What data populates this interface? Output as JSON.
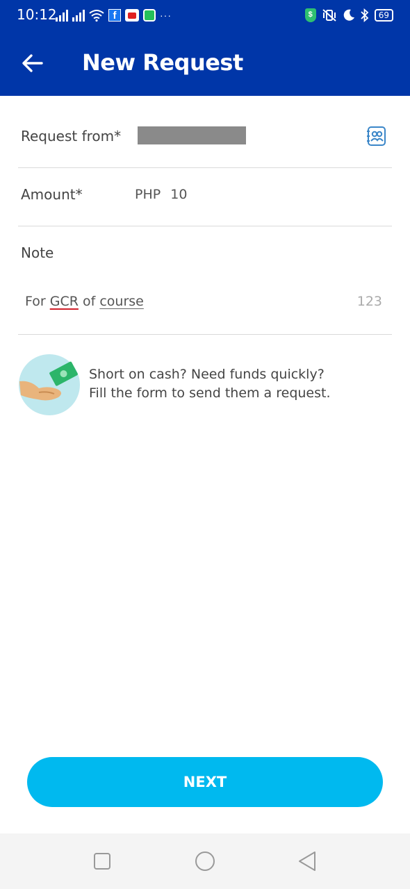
{
  "status_bar": {
    "time": "10:12",
    "battery": "69",
    "shield_glyph": "$",
    "overflow": "···",
    "facebook_glyph": "f",
    "icons": [
      "signal-icon",
      "wifi-icon",
      "facebook-icon",
      "youtube-icon",
      "message-icon",
      "shield-icon",
      "vibrate-icon",
      "moon-icon",
      "bluetooth-icon",
      "battery-icon"
    ]
  },
  "header": {
    "title": "New Request",
    "back_icon": "arrow-left-icon"
  },
  "form": {
    "request_from_label": "Request from*",
    "contacts_icon": "contacts-book-icon",
    "amount_label": "Amount*",
    "amount_currency": "PHP",
    "amount_value": "10",
    "note_label": "Note",
    "note_parts": [
      "For ",
      "GCR",
      " of ",
      "course"
    ],
    "note_counter": "123"
  },
  "info": {
    "line1": "Short on cash? Need funds quickly?",
    "line2": "Fill the form to send them a request.",
    "illustration": "hand-money-icon"
  },
  "next_button": {
    "label": "NEXT"
  },
  "colors": {
    "header_bg": "#0036a8",
    "button_bg": "#00b9ef",
    "divider": "#d9d9d9"
  },
  "nav_bar": {
    "icons": [
      "recents-square-icon",
      "home-circle-icon",
      "back-triangle-icon"
    ]
  }
}
